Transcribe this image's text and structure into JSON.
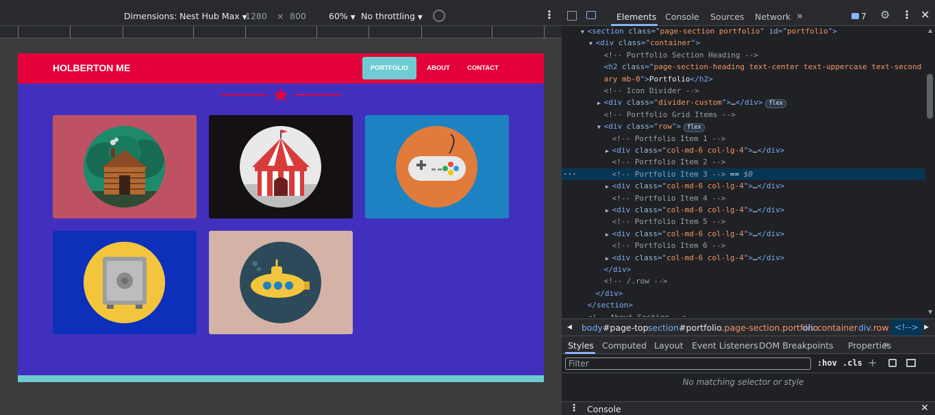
{
  "device_toolbar": {
    "dimensions_label": "Dimensions: Nest Hub Max",
    "width": "1280",
    "times": "×",
    "height": "800",
    "zoom": "60%",
    "throttling": "No throttling"
  },
  "page": {
    "brand": "HOLBERTON ME",
    "nav": [
      {
        "label": "PORTFOLIO",
        "active": true
      },
      {
        "label": "ABOUT",
        "active": false
      },
      {
        "label": "CONTACT",
        "active": false
      }
    ],
    "portfolio_items": [
      {
        "icon": "cabin-icon",
        "bg": "#bf5164"
      },
      {
        "icon": "circus-tent-icon",
        "bg": "#141013"
      },
      {
        "icon": "game-controller-icon",
        "bg": "#1d82c2"
      },
      {
        "icon": "safe-icon",
        "bg": "#0d30ba"
      },
      {
        "icon": "submarine-icon",
        "bg": "#d4b3a6"
      }
    ],
    "colors": {
      "nav_bg": "#e4003a",
      "page_bg": "#4130bd",
      "accent": "#6fcbd2"
    }
  },
  "devtools": {
    "tabs": [
      "Elements",
      "Console",
      "Sources",
      "Network"
    ],
    "active_tab": "Elements",
    "more_tabs": "»",
    "issues_count": "7",
    "dom_lines": [
      {
        "indent": 3,
        "arrow": "▼",
        "parts": [
          [
            "tag",
            "<section "
          ],
          [
            "attr",
            "class"
          ],
          [
            "tag",
            "=\""
          ],
          [
            "val",
            "page-section portfolio"
          ],
          [
            "tag",
            "\" "
          ],
          [
            "attr",
            "id"
          ],
          [
            "tag",
            "=\""
          ],
          [
            "val",
            "portfolio"
          ],
          [
            "tag",
            "\">"
          ]
        ]
      },
      {
        "indent": 4,
        "arrow": "▼",
        "parts": [
          [
            "tag",
            "<div "
          ],
          [
            "attr",
            "class"
          ],
          [
            "tag",
            "=\""
          ],
          [
            "val",
            "container"
          ],
          [
            "tag",
            "\">"
          ]
        ]
      },
      {
        "indent": 5,
        "arrow": "",
        "parts": [
          [
            "com",
            "<!-- Portfolio Section Heading -->"
          ]
        ]
      },
      {
        "indent": 5,
        "arrow": "",
        "parts": [
          [
            "tag",
            "<h2 "
          ],
          [
            "attr",
            "class"
          ],
          [
            "tag",
            "=\""
          ],
          [
            "val",
            "page-section-heading text-center text-uppercase text-second"
          ]
        ]
      },
      {
        "indent": 5,
        "arrow": "",
        "parts": [
          [
            "val",
            "ary mb-0"
          ],
          [
            "tag",
            "\">"
          ],
          [
            "txt",
            "Portfolio"
          ],
          [
            "tag",
            "</h2>"
          ]
        ]
      },
      {
        "indent": 5,
        "arrow": "",
        "parts": [
          [
            "com",
            "<!-- Icon Divider -->"
          ]
        ]
      },
      {
        "indent": 5,
        "arrow": "▶",
        "parts": [
          [
            "tag",
            "<div "
          ],
          [
            "attr",
            "class"
          ],
          [
            "tag",
            "=\""
          ],
          [
            "val",
            "divider-custom"
          ],
          [
            "tag",
            "\">"
          ],
          [
            "txt",
            "…"
          ],
          [
            "tag",
            "</div>"
          ]
        ],
        "badge": "flex"
      },
      {
        "indent": 5,
        "arrow": "",
        "parts": [
          [
            "com",
            "<!-- Portfolio Grid Items -->"
          ]
        ]
      },
      {
        "indent": 5,
        "arrow": "▼",
        "parts": [
          [
            "tag",
            "<div "
          ],
          [
            "attr",
            "class"
          ],
          [
            "tag",
            "=\""
          ],
          [
            "val",
            "row"
          ],
          [
            "tag",
            "\">"
          ]
        ],
        "badge": "flex"
      },
      {
        "indent": 6,
        "arrow": "",
        "parts": [
          [
            "com",
            "<!-- Portfolio Item 1 -->"
          ]
        ]
      },
      {
        "indent": 6,
        "arrow": "▶",
        "parts": [
          [
            "tag",
            "<div "
          ],
          [
            "attr",
            "class"
          ],
          [
            "tag",
            "=\""
          ],
          [
            "val",
            "col-md-6 col-lg-4"
          ],
          [
            "tag",
            "\">"
          ],
          [
            "txt",
            "…"
          ],
          [
            "tag",
            "</div>"
          ]
        ]
      },
      {
        "indent": 6,
        "arrow": "",
        "parts": [
          [
            "com",
            "<!-- Portfolio Item 2 -->"
          ]
        ]
      },
      {
        "indent": 6,
        "arrow": "",
        "parts": [
          [
            "com",
            "<!-- Portfolio Item 3 --> "
          ],
          [
            "txt",
            "== "
          ],
          [
            "com",
            "$0"
          ]
        ],
        "selected": true
      },
      {
        "indent": 6,
        "arrow": "▶",
        "parts": [
          [
            "tag",
            "<div "
          ],
          [
            "attr",
            "class"
          ],
          [
            "tag",
            "=\""
          ],
          [
            "val",
            "col-md-6 col-lg-4"
          ],
          [
            "tag",
            "\">"
          ],
          [
            "txt",
            "…"
          ],
          [
            "tag",
            "</div>"
          ]
        ]
      },
      {
        "indent": 6,
        "arrow": "",
        "parts": [
          [
            "com",
            "<!-- Portfolio Item 4 -->"
          ]
        ]
      },
      {
        "indent": 6,
        "arrow": "▶",
        "parts": [
          [
            "tag",
            "<div "
          ],
          [
            "attr",
            "class"
          ],
          [
            "tag",
            "=\""
          ],
          [
            "val",
            "col-md-6 col-lg-4"
          ],
          [
            "tag",
            "\">"
          ],
          [
            "txt",
            "…"
          ],
          [
            "tag",
            "</div>"
          ]
        ]
      },
      {
        "indent": 6,
        "arrow": "",
        "parts": [
          [
            "com",
            "<!-- Portfolio Item 5 -->"
          ]
        ]
      },
      {
        "indent": 6,
        "arrow": "▶",
        "parts": [
          [
            "tag",
            "<div "
          ],
          [
            "attr",
            "class"
          ],
          [
            "tag",
            "=\""
          ],
          [
            "val",
            "col-md-6 col-lg-4"
          ],
          [
            "tag",
            "\">"
          ],
          [
            "txt",
            "…"
          ],
          [
            "tag",
            "</div>"
          ]
        ]
      },
      {
        "indent": 6,
        "arrow": "",
        "parts": [
          [
            "com",
            "<!-- Portfolio Item 6 -->"
          ]
        ]
      },
      {
        "indent": 6,
        "arrow": "▶",
        "parts": [
          [
            "tag",
            "<div "
          ],
          [
            "attr",
            "class"
          ],
          [
            "tag",
            "=\""
          ],
          [
            "val",
            "col-md-6 col-lg-4"
          ],
          [
            "tag",
            "\">"
          ],
          [
            "txt",
            "…"
          ],
          [
            "tag",
            "</div>"
          ]
        ]
      },
      {
        "indent": 5,
        "arrow": "",
        "parts": [
          [
            "tag",
            "</div>"
          ]
        ]
      },
      {
        "indent": 5,
        "arrow": "",
        "parts": [
          [
            "com",
            "<!-- /.row -->"
          ]
        ]
      },
      {
        "indent": 4,
        "arrow": "",
        "parts": [
          [
            "tag",
            "</div>"
          ]
        ]
      },
      {
        "indent": 3,
        "arrow": "",
        "parts": [
          [
            "tag",
            "</section>"
          ]
        ]
      },
      {
        "indent": 3,
        "arrow": "",
        "parts": [
          [
            "com",
            "<!-- About Section -->"
          ]
        ]
      }
    ],
    "breadcrumbs": [
      {
        "a": "body",
        "b": "#page-top",
        "c": ""
      },
      {
        "a": "section",
        "b": "#portfolio",
        "c": ".page-section.portfolio"
      },
      {
        "a": "div",
        "b": "",
        "c": ".container"
      },
      {
        "a": "div",
        "b": "",
        "c": ".row"
      },
      {
        "a": "<!-->",
        "b": "",
        "c": ""
      }
    ],
    "styles_tabs": [
      "Styles",
      "Computed",
      "Layout",
      "Event Listeners",
      "DOM Breakpoints",
      "Properties"
    ],
    "filter_placeholder": "Filter",
    "hov": ":hov",
    "cls": ".cls",
    "no_match": "No matching selector or style",
    "console_label": "Console"
  }
}
